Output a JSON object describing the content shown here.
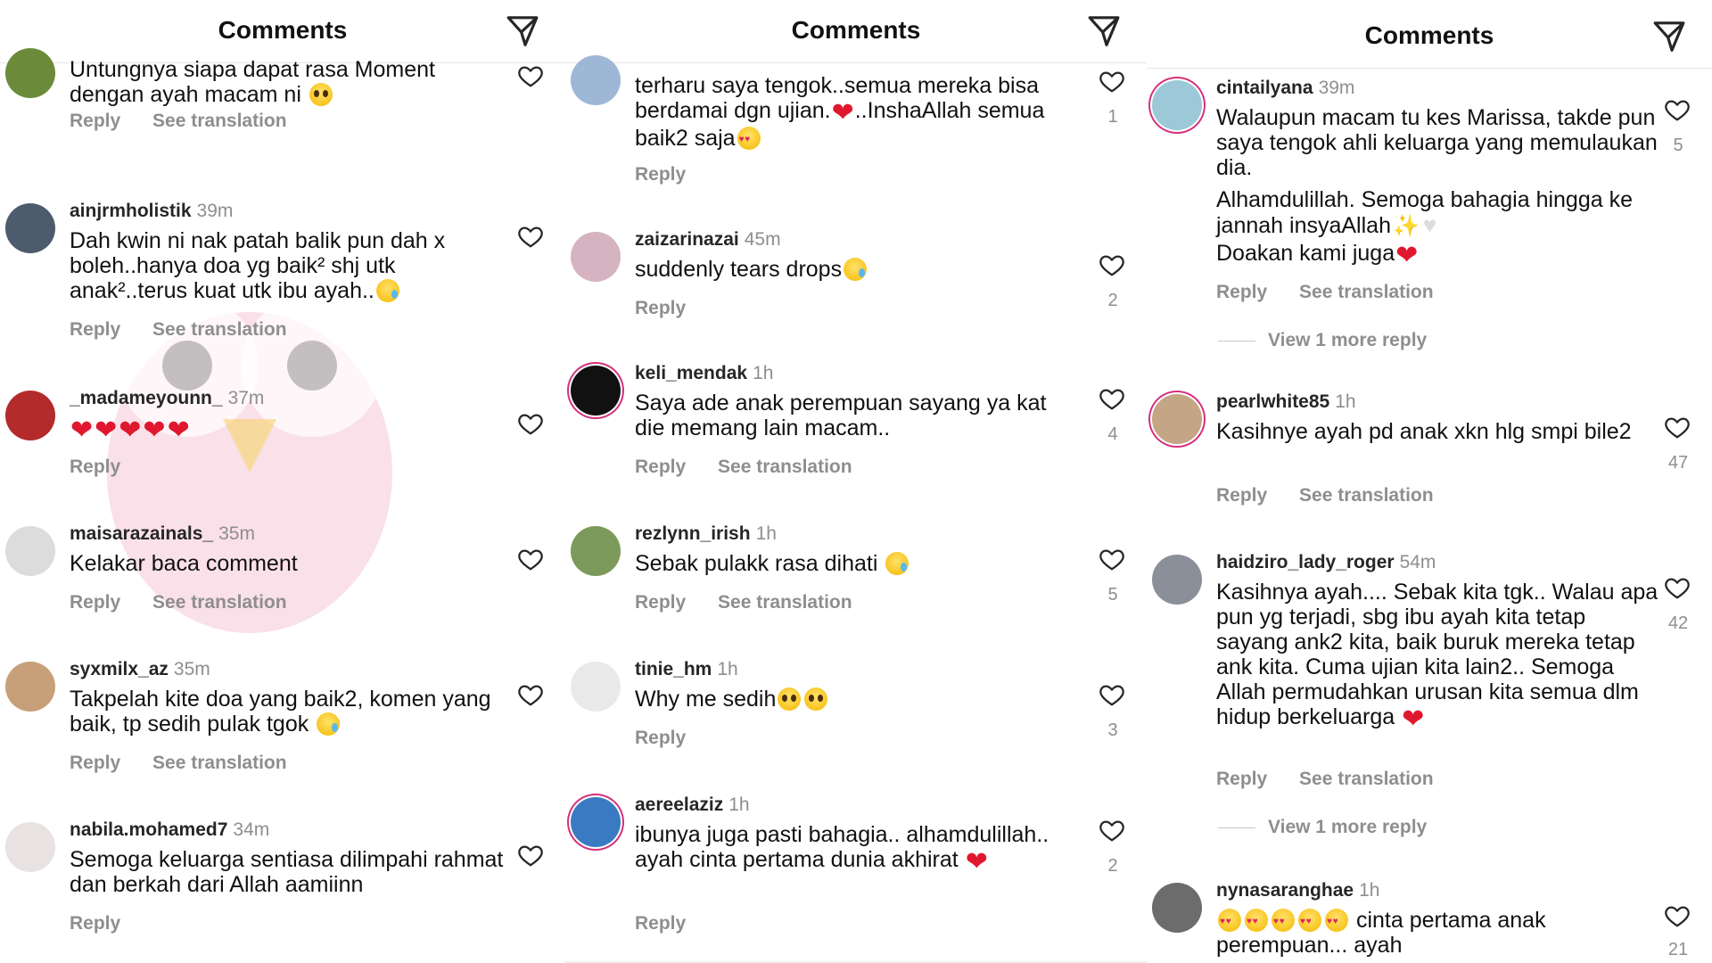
{
  "header": {
    "title": "Comments"
  },
  "icons": {
    "send": "paper-plane-icon",
    "like": "heart-outline-icon"
  },
  "colors": {
    "ring": "#d4307c",
    "heart_emoji": "#e0182f",
    "secondary_text": "#8e8e8e"
  },
  "actions": {
    "reply": "Reply",
    "translate": "See translation",
    "more_replies": "View 1 more reply"
  },
  "panel1": {
    "c0": {
      "text": "Untungnya siapa dapat rasa Moment dengan ayah macam ni"
    },
    "c1": {
      "user": "ainjrmholistik",
      "time": "39m",
      "text": "Dah kwin ni nak patah balik pun dah x boleh..hanya doa yg baik² shj utk anak²..terus kuat utk ibu ayah.."
    },
    "c2": {
      "user": "_madameyounn_",
      "time": "37m"
    },
    "c3": {
      "user": "maisarazainals_",
      "time": "35m",
      "text": "Kelakar baca comment"
    },
    "c4": {
      "user": "syxmilx_az",
      "time": "35m",
      "text": "Takpelah kite doa yang baik2, komen yang baik,  tp sedih pulak tgok"
    },
    "c5": {
      "user": "nabila.mohamed7",
      "time": "34m",
      "text": "Semoga keluarga sentiasa dilimpahi rahmat dan berkah dari Allah aamiinn"
    }
  },
  "panel2": {
    "c0": {
      "text_a": "terharu saya tengok..semua mereka bisa berdamai dgn ujian.",
      "text_b": "..InshaAllah semua baik2 saja",
      "likes": "1"
    },
    "c1": {
      "user": "zaizarinazai",
      "time": "45m",
      "text": "suddenly tears drops",
      "likes": "2"
    },
    "c2": {
      "user": "keli_mendak",
      "time": "1h",
      "text": "Saya ade anak perempuan sayang ya kat die memang lain macam..",
      "likes": "4"
    },
    "c3": {
      "user": "rezlynn_irish",
      "time": "1h",
      "text": "Sebak pulakk rasa dihati",
      "likes": "5"
    },
    "c4": {
      "user": "tinie_hm",
      "time": "1h",
      "text": "Why me sedih",
      "likes": "3"
    },
    "c5": {
      "user": "aereelaziz",
      "time": "1h",
      "text": "ibunya juga pasti bahagia.. alhamdulillah.. ayah cinta pertama dunia akhirat",
      "likes": "2"
    }
  },
  "panel3": {
    "c1": {
      "user": "cintailyana",
      "time": "39m",
      "text": "Walaupun macam tu kes Marissa, takde pun saya tengok ahli keluarga yang memulaukan dia.",
      "text2": "Alhamdulillah. Semoga bahagia hingga ke jannah insyaAllah",
      "text3": "Doakan kami juga",
      "likes": "5"
    },
    "c2": {
      "user": "pearlwhite85",
      "time": "1h",
      "text": "Kasihnye ayah pd anak xkn hlg smpi bile2",
      "likes": "47"
    },
    "c3": {
      "user": "haidziro_lady_roger",
      "time": "54m",
      "text": "Kasihnya ayah.... Sebak kita tgk.. Walau apa pun yg terjadi, sbg ibu ayah kita tetap sayang ank2 kita, baik buruk mereka tetap ank kita. Cuma ujian kita lain2.. Semoga Allah permudahkan urusan kita semua dlm hidup berkeluarga",
      "likes": "42"
    },
    "c4": {
      "user": "nynasaranghae",
      "time": "1h",
      "text": "cinta pertama anak perempuan... ayah",
      "likes": "21"
    }
  }
}
